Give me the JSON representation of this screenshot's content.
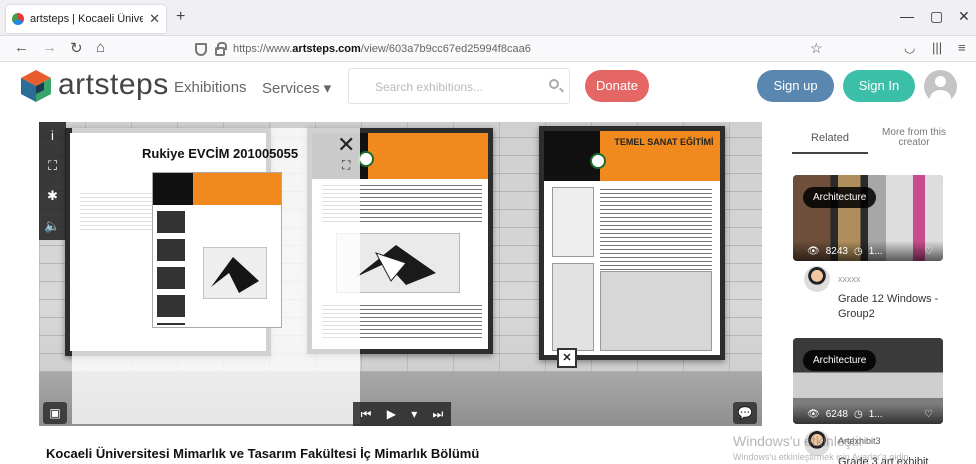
{
  "browser": {
    "tab_title": "artsteps | Kocaeli Üniversitesi M",
    "url_prefix": "https://www.",
    "url_domain": "artsteps.com",
    "url_path": "/view/603a7b9cc67ed25994f8caa6"
  },
  "header": {
    "logo_text": "artsteps",
    "nav": [
      "Exhibitions",
      "Services ▾"
    ],
    "search_placeholder": "Search exhibitions...",
    "donate": "Donate",
    "signup": "Sign up",
    "signin": "Sign In"
  },
  "viewer": {
    "overlay_title": "Rukiye EVCİM 201005055",
    "poster_header_center": "TEMEL SANAT EĞİTİMİ",
    "controls": [
      "⏮",
      "▶",
      "▾",
      "⏭"
    ]
  },
  "page_title": "Kocaeli Üniversitesi Mimarlık ve Tasarım Fakültesi İç Mimarlık Bölümü",
  "sidebar": {
    "tab_related": "Related",
    "tab_more": "More from this creator",
    "cards": [
      {
        "badge": "Architecture",
        "views": "8243",
        "extra": "1...",
        "user": "xxxxx",
        "title": "Grade 12 Windows - Group2"
      },
      {
        "badge": "Architecture",
        "views": "6248",
        "extra": "1...",
        "user": "Artexhibit3",
        "title": "Grade 3 art exhibit"
      }
    ]
  },
  "watermark": {
    "line1": "Windows'u etkinleştir",
    "line2": "Windows'u etkinleştirmek için Ayarlar'a gidin."
  },
  "colors": {
    "donate": "#e46766",
    "signup": "#5a87b0",
    "signin": "#3bbfa8",
    "poster_orange": "#f08a1e"
  }
}
